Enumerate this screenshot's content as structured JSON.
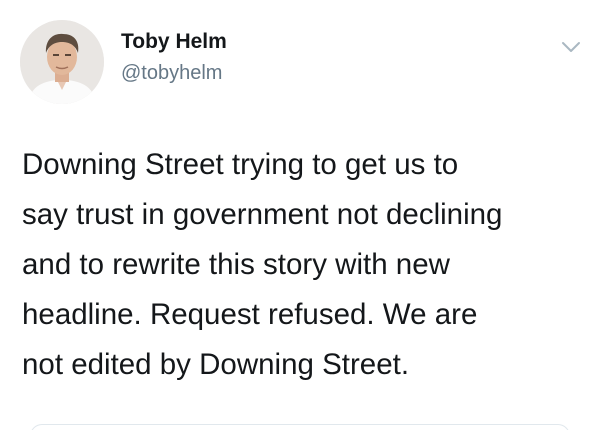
{
  "author": {
    "display_name": "Toby Helm",
    "handle": "@tobyhelm"
  },
  "tweet": {
    "lines": [
      "Downing Street trying to get us to",
      "say trust in government not declining",
      "and to rewrite this story with new",
      "headline. Request refused. We are",
      "not edited by Downing Street."
    ]
  },
  "icons": {
    "menu": "chevron-down-icon",
    "avatar": "avatar"
  },
  "colors": {
    "text": "#14171a",
    "secondary_text": "#657786",
    "chevron": "#aab8c2"
  }
}
